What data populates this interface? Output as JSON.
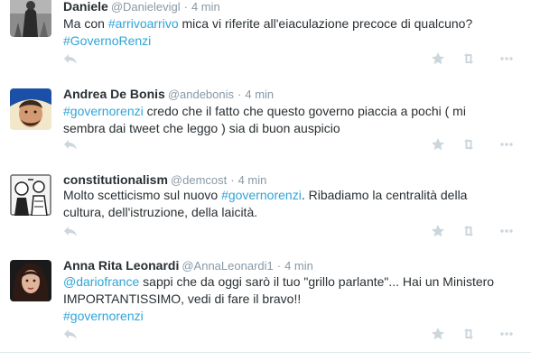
{
  "tweets": [
    {
      "name": "Daniele",
      "handle": "@Danielevigl",
      "sep": "·",
      "time": "4 min",
      "lines": [
        [
          {
            "t": "text",
            "v": "Ma con "
          },
          {
            "t": "hashtag",
            "v": "#arrivoarrivo"
          },
          {
            "t": "text",
            "v": " mica vi riferite all'eiaculazione precoce di qualcuno?"
          }
        ],
        [
          {
            "t": "hashtag",
            "v": "#GovernoRenzi"
          }
        ]
      ]
    },
    {
      "name": "Andrea De Bonis",
      "handle": "@andebonis",
      "sep": "·",
      "time": "4 min",
      "lines": [
        [
          {
            "t": "hashtag",
            "v": "#governorenzi"
          },
          {
            "t": "text",
            "v": " credo che il fatto che questo governo piaccia a pochi ( mi"
          }
        ],
        [
          {
            "t": "text",
            "v": "sembra dai tweet che leggo ) sia di buon auspicio"
          }
        ]
      ]
    },
    {
      "name": "constitutionalism",
      "handle": "@demcost",
      "sep": "·",
      "time": "4 min",
      "lines": [
        [
          {
            "t": "text",
            "v": "Molto scetticismo sul nuovo "
          },
          {
            "t": "hashtag",
            "v": "#governorenzi"
          },
          {
            "t": "text",
            "v": ". Ribadiamo la centralità della"
          }
        ],
        [
          {
            "t": "text",
            "v": "cultura, dell'istruzione, della laicità."
          }
        ]
      ]
    },
    {
      "name": "Anna Rita Leonardi",
      "handle": "@AnnaLeonardi1",
      "sep": "·",
      "time": "4 min",
      "lines": [
        [
          {
            "t": "mention",
            "v": "@dariofrance"
          },
          {
            "t": "text",
            "v": " sappi che da oggi sarò il tuo \"grillo parlante\"... Hai un Ministero"
          }
        ],
        [
          {
            "t": "text",
            "v": "IMPORTANTISSIMO, vedi di fare il bravo!!"
          }
        ],
        [
          {
            "t": "hashtag",
            "v": "#governorenzi"
          }
        ]
      ]
    }
  ],
  "actions": {
    "reply": "reply-icon",
    "favorite": "star-icon",
    "retweet": "retweet-icon",
    "more": "more-icon"
  },
  "colors": {
    "hashtag": "#2fa4d8",
    "meta": "#8899a6",
    "icon": "#ccd6dd",
    "divider": "#e1e8ed"
  }
}
